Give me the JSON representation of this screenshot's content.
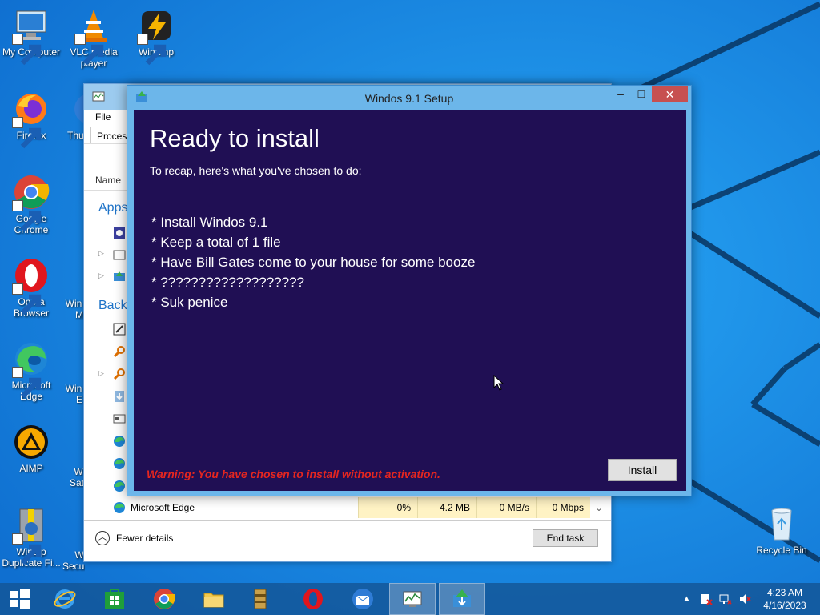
{
  "desktop": {
    "icons": [
      {
        "label": "My Computer",
        "icon": "computer-icon"
      },
      {
        "label": "VLC media player",
        "icon": "vlc-cone-icon"
      },
      {
        "label": "Winamp",
        "icon": "winamp-icon"
      },
      {
        "label": "Firefox",
        "icon": "firefox-icon"
      },
      {
        "label": "Thu",
        "icon": "thunderbird-icon"
      },
      {
        "label": "Google Chrome",
        "icon": "chrome-icon"
      },
      {
        "label": "Opera Browser",
        "icon": "opera-icon"
      },
      {
        "label": "Microsoft Edge",
        "icon": "edge-icon"
      },
      {
        "label": "AIMP",
        "icon": "aimp-icon"
      },
      {
        "label": "WinZip Duplicate Fi...",
        "icon": "winzip-icon"
      }
    ],
    "partial_labels": [
      "Win",
      "M",
      "Win",
      "E",
      "W",
      "Sat",
      "W",
      "Secur..."
    ],
    "recycle_bin": {
      "label": "Recycle Bin",
      "icon": "recycle-bin-icon"
    }
  },
  "task_manager": {
    "menu": "File",
    "tab": "Process",
    "column_header": "Name",
    "group_apps": "Apps",
    "group_background": "Backg",
    "edge_row": {
      "name": "Microsoft Edge",
      "cpu": "0%",
      "memory": "4.2 MB",
      "disk": "0 MB/s",
      "network": "0 Mbps"
    },
    "fewer_details": "Fewer details",
    "end_task": "End task"
  },
  "setup_dialog": {
    "title": "Windos 9.1 Setup",
    "heading": "Ready to install",
    "subtitle": "To recap, here's what you've chosen to do:",
    "choices": [
      "* Install Windos 9.1",
      "* Keep a total of 1 file",
      "* Have Bill Gates come to your house for some booze",
      "* ???????????????????",
      "* Suk penice"
    ],
    "warning": "Warning: You have chosen to install without activation.",
    "install_button": "Install",
    "colors": {
      "background": "#200f54",
      "warning": "#e52620",
      "frame": "#6cb6ea"
    }
  },
  "taskbar": {
    "items": [
      "start-button",
      "internet-explorer-icon",
      "store-icon",
      "chrome-icon",
      "file-explorer-icon",
      "winrar-icon",
      "opera-icon",
      "thunderbird-icon",
      "task-manager-icon",
      "setup-icon"
    ],
    "clock_time": "4:23 AM",
    "clock_date": "4/16/2023"
  }
}
